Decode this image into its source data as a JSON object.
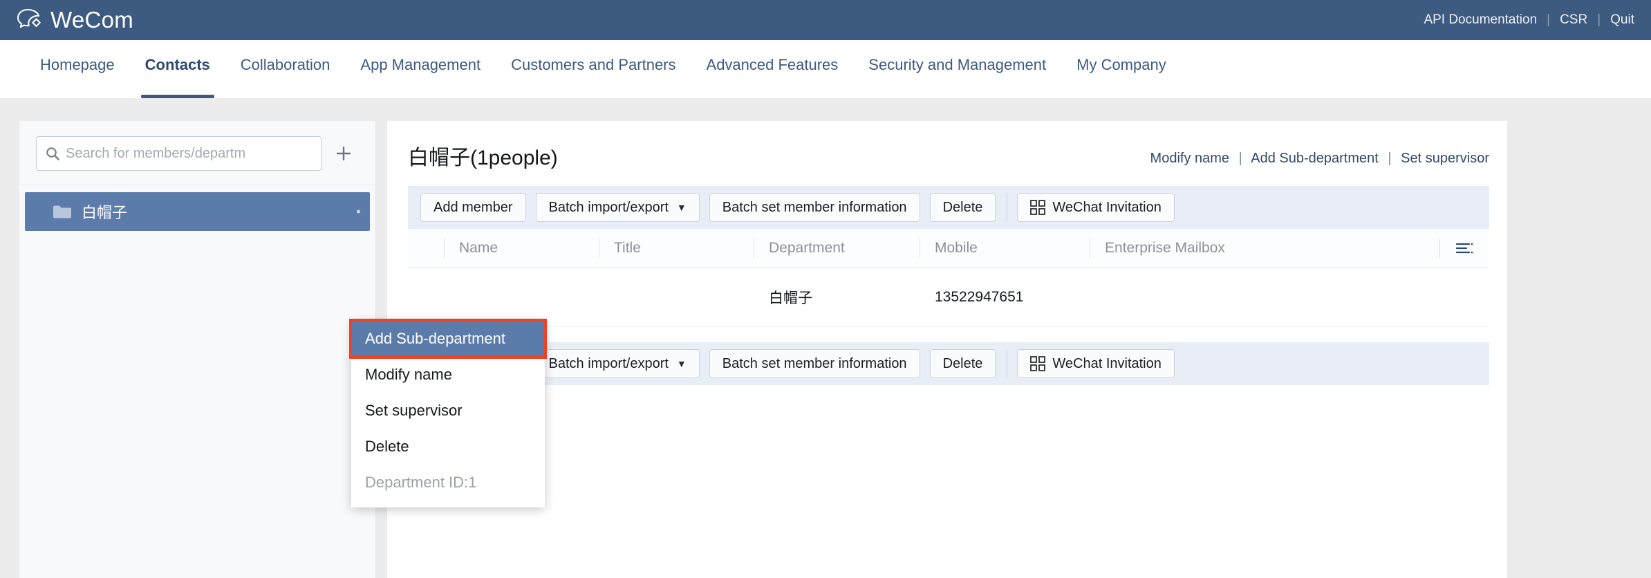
{
  "topbar": {
    "brand": "WeCom",
    "logo_icon": "wecom-logo-icon",
    "links": [
      {
        "label": "API Documentation",
        "name": "api-documentation-link"
      },
      {
        "label": "CSR",
        "name": "csr-link"
      },
      {
        "label": "Quit",
        "name": "quit-link"
      }
    ],
    "separator": "|"
  },
  "nav": {
    "items": [
      {
        "label": "Homepage",
        "active": false
      },
      {
        "label": "Contacts",
        "active": true
      },
      {
        "label": "Collaboration",
        "active": false
      },
      {
        "label": "App Management",
        "active": false
      },
      {
        "label": "Customers and Partners",
        "active": false
      },
      {
        "label": "Advanced Features",
        "active": false
      },
      {
        "label": "Security and Management",
        "active": false
      },
      {
        "label": "My Company",
        "active": false
      }
    ]
  },
  "sidebar": {
    "search": {
      "value": "",
      "placeholder": "Search for members/departm",
      "icon": "search-icon"
    },
    "add_button_icon": "plus-icon",
    "tree": [
      {
        "label": "白帽子",
        "icon": "folder-icon",
        "selected": true
      }
    ]
  },
  "context_menu": {
    "items": [
      {
        "label": "Add Sub-department",
        "state": "highlighted"
      },
      {
        "label": "Modify name",
        "state": "normal"
      },
      {
        "label": "Set supervisor",
        "state": "normal"
      },
      {
        "label": "Delete",
        "state": "normal"
      },
      {
        "label": "Department ID:1",
        "state": "disabled"
      }
    ],
    "highlight_color": "#ef4123",
    "selected_bg": "#5b7cab"
  },
  "main": {
    "title": "白帽子(1people)",
    "head_links": [
      {
        "label": "Modify name"
      },
      {
        "label": "Add Sub-department"
      },
      {
        "label": "Set supervisor"
      }
    ],
    "head_link_separator": "|",
    "toolbar": {
      "add_member_label": "Add member",
      "batch_label": "Batch import/export",
      "batch_caret": "▼",
      "batch_set_label": "Batch set member information",
      "delete_label": "Delete",
      "invite_label": "WeChat Invitation",
      "invite_icon": "qr-code-icon"
    },
    "table": {
      "columns": [
        "Name",
        "Title",
        "Department",
        "Mobile",
        "Enterprise Mailbox"
      ],
      "settings_icon": "column-settings-icon",
      "rows": [
        {
          "name": "",
          "title": "",
          "department": "白帽子",
          "mobile": "13522947651",
          "mailbox": ""
        }
      ]
    }
  }
}
